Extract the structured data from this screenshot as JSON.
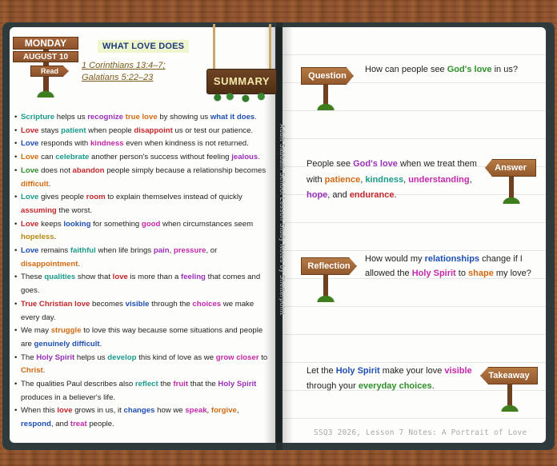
{
  "date_sign": {
    "day": "MONDAY",
    "date": "AUGUST 10",
    "action": "Read"
  },
  "lesson_title": "WHAT LOVE DOES",
  "references": [
    "1 Corinthians 13:4–7;",
    "Galatians 5:22–23"
  ],
  "summary_label": "SUMMARY",
  "side_text": "Adult Sabbath School Lesson Study Notes by Shelterpoint",
  "colors": {
    "teal": "#1a9a8a",
    "blue": "#1f4fb0",
    "red": "#c0282c",
    "orange": "#d06a12",
    "purple": "#9a2fb8",
    "magenta": "#c227a8",
    "green": "#2f8f2a",
    "gold": "#b58a12"
  },
  "bullets": [
    [
      {
        "t": "Scripture",
        "c": "teal"
      },
      {
        "t": " helps us "
      },
      {
        "t": "recognize",
        "c": "purple"
      },
      {
        "t": " "
      },
      {
        "t": "true love",
        "c": "orange"
      },
      {
        "t": " by showing us "
      },
      {
        "t": "what it does",
        "c": "blue"
      },
      {
        "t": "."
      }
    ],
    [
      {
        "t": "Love",
        "c": "red"
      },
      {
        "t": " stays "
      },
      {
        "t": "patient",
        "c": "teal"
      },
      {
        "t": " when people "
      },
      {
        "t": "disappoint",
        "c": "red"
      },
      {
        "t": " us or test our patience."
      }
    ],
    [
      {
        "t": "Love",
        "c": "blue"
      },
      {
        "t": " responds with "
      },
      {
        "t": "kindness",
        "c": "magenta"
      },
      {
        "t": " even when kindness is not returned."
      }
    ],
    [
      {
        "t": "Love",
        "c": "orange"
      },
      {
        "t": " can "
      },
      {
        "t": "celebrate",
        "c": "teal"
      },
      {
        "t": " another person's success without feeling "
      },
      {
        "t": "jealous",
        "c": "purple"
      },
      {
        "t": "."
      }
    ],
    [
      {
        "t": "Love",
        "c": "green"
      },
      {
        "t": " does not "
      },
      {
        "t": "abandon",
        "c": "red"
      },
      {
        "t": " people simply because a relationship becomes "
      },
      {
        "t": "difficult",
        "c": "orange"
      },
      {
        "t": "."
      }
    ],
    [
      {
        "t": "Love",
        "c": "teal"
      },
      {
        "t": " gives people "
      },
      {
        "t": "room",
        "c": "red"
      },
      {
        "t": " to explain themselves instead of quickly "
      },
      {
        "t": "assuming",
        "c": "red"
      },
      {
        "t": " the worst."
      }
    ],
    [
      {
        "t": "Love",
        "c": "red"
      },
      {
        "t": " keeps "
      },
      {
        "t": "looking",
        "c": "blue"
      },
      {
        "t": " for something "
      },
      {
        "t": "good",
        "c": "magenta"
      },
      {
        "t": " when circumstances seem "
      },
      {
        "t": "hopeless",
        "c": "gold"
      },
      {
        "t": "."
      }
    ],
    [
      {
        "t": "Love",
        "c": "blue"
      },
      {
        "t": " remains "
      },
      {
        "t": "faithful",
        "c": "teal"
      },
      {
        "t": " when life brings "
      },
      {
        "t": "pain",
        "c": "purple"
      },
      {
        "t": ", "
      },
      {
        "t": "pressure",
        "c": "magenta"
      },
      {
        "t": ", or "
      },
      {
        "t": "disappointment",
        "c": "orange"
      },
      {
        "t": "."
      }
    ],
    [
      {
        "t": "These "
      },
      {
        "t": "qualities",
        "c": "teal"
      },
      {
        "t": " show that "
      },
      {
        "t": "love",
        "c": "red"
      },
      {
        "t": " is more than a "
      },
      {
        "t": "feeling",
        "c": "purple"
      },
      {
        "t": " that comes and goes."
      }
    ],
    [
      {
        "t": "True Christian love",
        "c": "red"
      },
      {
        "t": " becomes "
      },
      {
        "t": "visible",
        "c": "blue"
      },
      {
        "t": " through the "
      },
      {
        "t": "choices",
        "c": "magenta"
      },
      {
        "t": " we make every day."
      }
    ],
    [
      {
        "t": "We may "
      },
      {
        "t": "struggle",
        "c": "orange"
      },
      {
        "t": " to love this way because some situations and people are "
      },
      {
        "t": "genuinely difficult",
        "c": "blue"
      },
      {
        "t": "."
      }
    ],
    [
      {
        "t": "The "
      },
      {
        "t": "Holy Spirit",
        "c": "purple"
      },
      {
        "t": " helps us "
      },
      {
        "t": "develop",
        "c": "teal"
      },
      {
        "t": " this kind of love as we "
      },
      {
        "t": "grow closer",
        "c": "magenta"
      },
      {
        "t": " to "
      },
      {
        "t": "Christ",
        "c": "orange"
      },
      {
        "t": "."
      }
    ],
    [
      {
        "t": "The qualities Paul describes also "
      },
      {
        "t": "reflect",
        "c": "teal"
      },
      {
        "t": " the "
      },
      {
        "t": "fruit",
        "c": "magenta"
      },
      {
        "t": " that the "
      },
      {
        "t": "Holy Spirit",
        "c": "purple"
      },
      {
        "t": " produces in a believer's life."
      }
    ],
    [
      {
        "t": "When this "
      },
      {
        "t": "love",
        "c": "red"
      },
      {
        "t": " grows in us, it "
      },
      {
        "t": "changes",
        "c": "blue"
      },
      {
        "t": " how we "
      },
      {
        "t": "speak",
        "c": "magenta"
      },
      {
        "t": ", "
      },
      {
        "t": "forgive",
        "c": "orange"
      },
      {
        "t": ", "
      },
      {
        "t": "respond",
        "c": "blue"
      },
      {
        "t": ", and "
      },
      {
        "t": "treat",
        "c": "magenta"
      },
      {
        "t": " people."
      }
    ]
  ],
  "question": {
    "label": "Question",
    "text": [
      {
        "t": "How can people see "
      },
      {
        "t": "God's love",
        "c": "green"
      },
      {
        "t": " in us?"
      }
    ]
  },
  "answer": {
    "label": "Answer",
    "text": [
      {
        "t": "People see "
      },
      {
        "t": "God's love",
        "c": "purple"
      },
      {
        "t": " when we treat them with "
      },
      {
        "t": "patience",
        "c": "orange"
      },
      {
        "t": ", "
      },
      {
        "t": "kindness",
        "c": "teal"
      },
      {
        "t": ", "
      },
      {
        "t": "understanding",
        "c": "magenta"
      },
      {
        "t": ", "
      },
      {
        "t": "hope",
        "c": "purple"
      },
      {
        "t": ", and "
      },
      {
        "t": "endurance",
        "c": "red"
      },
      {
        "t": "."
      }
    ]
  },
  "reflection": {
    "label": "Reflection",
    "text": [
      {
        "t": "How would my "
      },
      {
        "t": "relationships",
        "c": "blue"
      },
      {
        "t": " change if I allowed the "
      },
      {
        "t": "Holy Spirit",
        "c": "magenta"
      },
      {
        "t": " to "
      },
      {
        "t": "shape",
        "c": "orange"
      },
      {
        "t": " my love?"
      }
    ]
  },
  "takeaway": {
    "label": "Takeaway",
    "text": [
      {
        "t": "Let the "
      },
      {
        "t": "Holy Spirit",
        "c": "blue"
      },
      {
        "t": " make your love "
      },
      {
        "t": "visible",
        "c": "magenta"
      },
      {
        "t": " through your "
      },
      {
        "t": "everyday choices",
        "c": "green"
      },
      {
        "t": "."
      }
    ]
  },
  "footer": "SSQ3 2026, Lesson 7 Notes: A Portrait of Love"
}
